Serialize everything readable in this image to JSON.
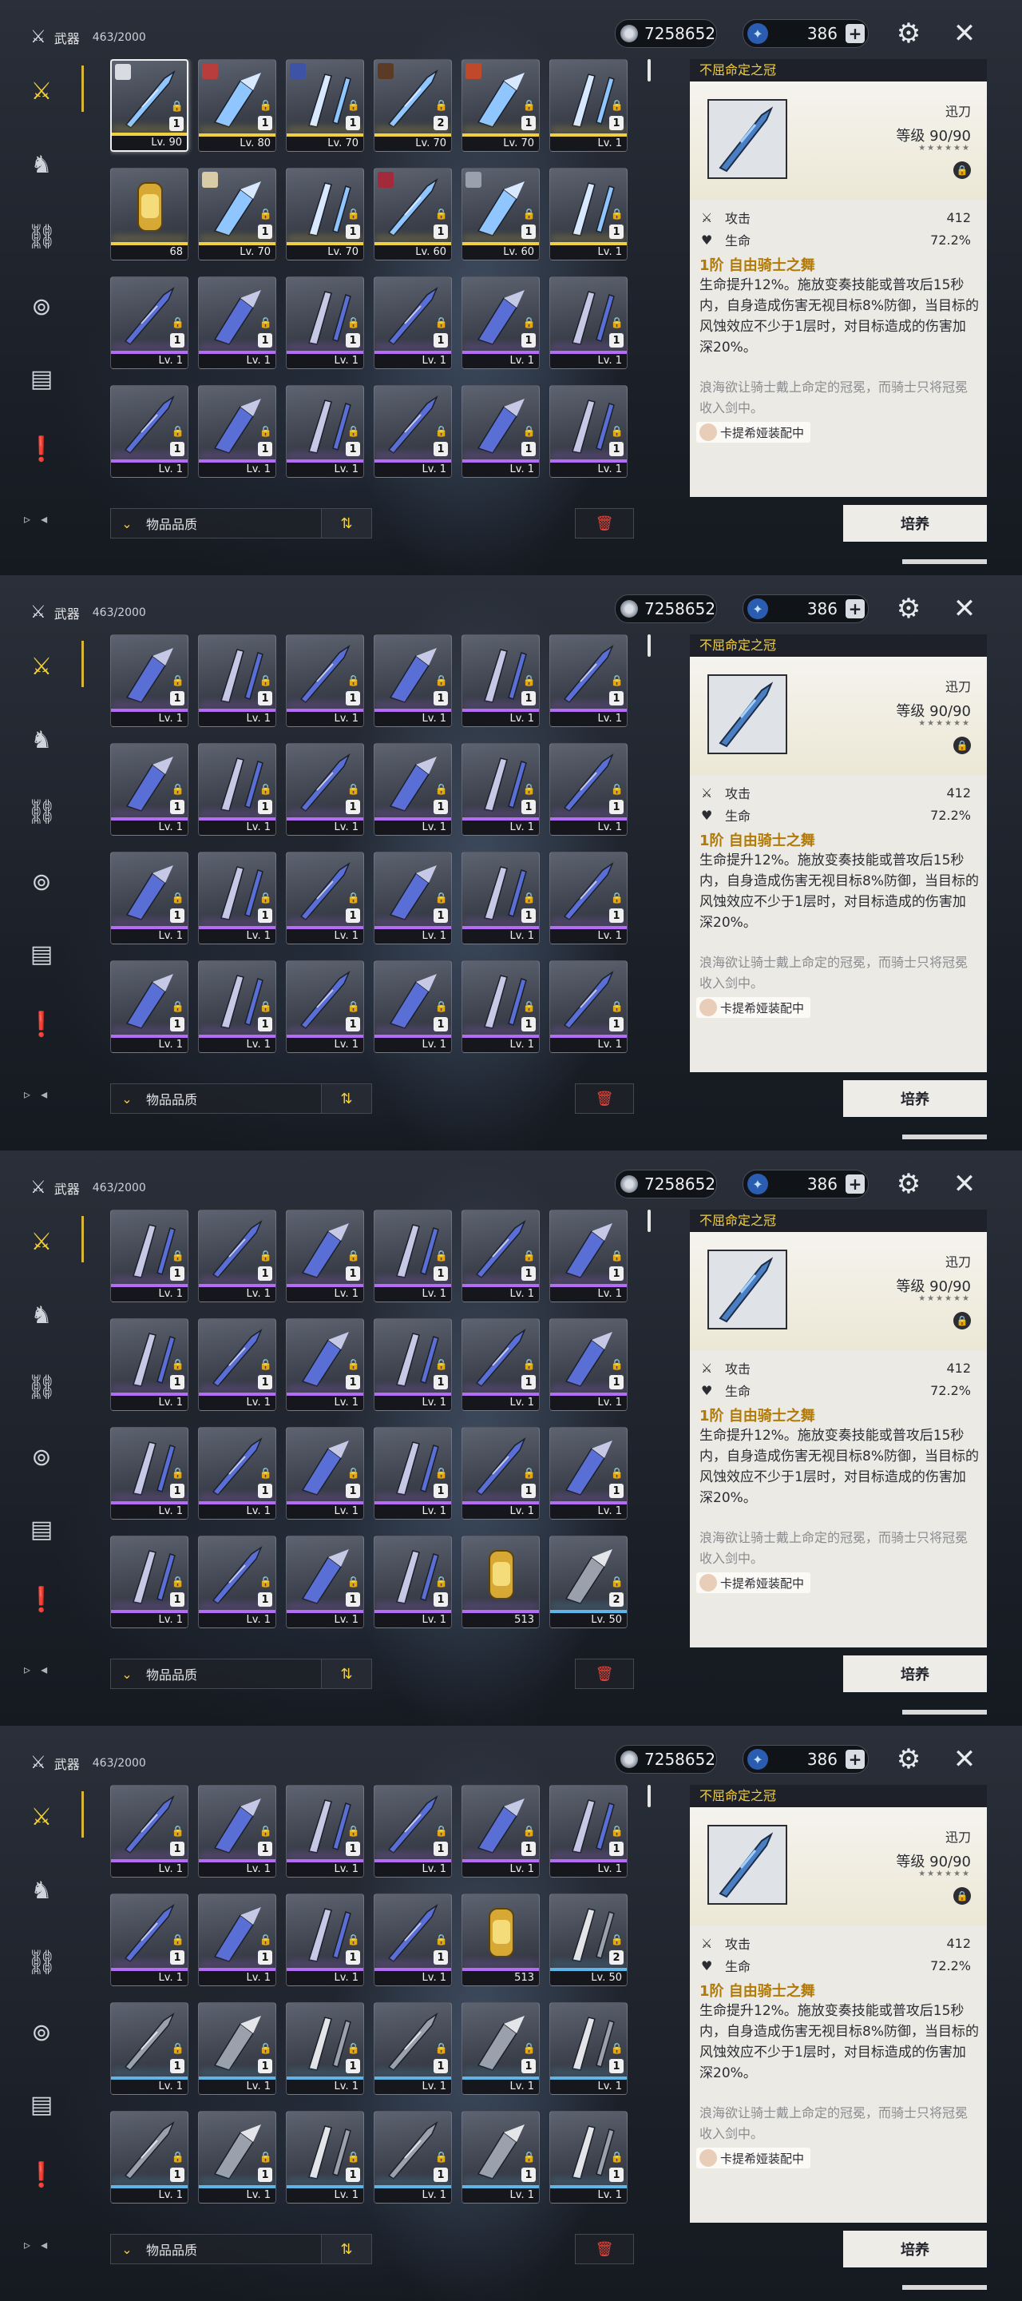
{
  "header": {
    "category_label": "武器",
    "inventory_count": "463/2000",
    "coins": "7258652",
    "stars": "386",
    "plus": "+"
  },
  "sidebar": {
    "icons": [
      "weapon-icon",
      "echo-icon",
      "ring-icon",
      "material-icon",
      "consumable-icon",
      "quest-item-icon"
    ]
  },
  "detail": {
    "title": "不屈命定之冠",
    "weapon_type": "迅刀",
    "level_label": "等级",
    "level": "90/90",
    "stars": "★★★★★★",
    "stat1_name": "攻击",
    "stat1_value": "412",
    "stat2_name": "生命",
    "stat2_value": "72.2%",
    "skill_name": "1阶 自由骑士之舞",
    "skill_desc": "生命提升12%。施放变奏技能或普攻后15秒内，自身造成伤害无视目标8%防御，当目标的风蚀效应不少于1层时，对目标造成的伤害加深20%。",
    "lore": "浪海欲让骑士戴上命定的冠冕，而骑士只将冠冕收入剑中。",
    "equipped_by": "卡提希娅装配中"
  },
  "footer": {
    "sort_label": "物品品质",
    "sort_icon": "⇅",
    "delete_icon": "🗑",
    "upgrade_label": "培养",
    "page_arrows": "▹ ◂"
  },
  "panels": [
    {
      "rows": [
        [
          {
            "r": 5,
            "lv": "Lv. 90",
            "badge": "1",
            "av": "#d8dbe2",
            "sel": true
          },
          {
            "r": 5,
            "lv": "Lv. 80",
            "badge": "1",
            "av": "#b93d3d"
          },
          {
            "r": 5,
            "lv": "Lv. 70",
            "badge": "1",
            "av": "#3d54a6"
          },
          {
            "r": 5,
            "lv": "Lv. 70",
            "badge": "2",
            "av": "#5b3b26"
          },
          {
            "r": 5,
            "lv": "Lv. 70",
            "badge": "1",
            "av": "#c0492b"
          },
          {
            "r": 5,
            "lv": "Lv. 1",
            "badge": "1"
          }
        ],
        [
          {
            "r": 5,
            "amt": "68",
            "item": true
          },
          {
            "r": 5,
            "lv": "Lv. 70",
            "badge": "1",
            "av": "#d9cba6"
          },
          {
            "r": 5,
            "lv": "Lv. 70",
            "badge": "1"
          },
          {
            "r": 5,
            "lv": "Lv. 60",
            "badge": "1",
            "av": "#a22a3a"
          },
          {
            "r": 5,
            "lv": "Lv. 60",
            "badge": "1",
            "av": "#9aa0ac"
          },
          {
            "r": 5,
            "lv": "Lv. 1",
            "badge": "1"
          }
        ],
        [
          {
            "r": 4,
            "lv": "Lv. 1",
            "badge": "1"
          },
          {
            "r": 4,
            "lv": "Lv. 1",
            "badge": "1"
          },
          {
            "r": 4,
            "lv": "Lv. 1",
            "badge": "1"
          },
          {
            "r": 4,
            "lv": "Lv. 1",
            "badge": "1"
          },
          {
            "r": 4,
            "lv": "Lv. 1",
            "badge": "1"
          },
          {
            "r": 4,
            "lv": "Lv. 1",
            "badge": "1"
          }
        ],
        [
          {
            "r": 4,
            "lv": "Lv. 1",
            "badge": "1"
          },
          {
            "r": 4,
            "lv": "Lv. 1",
            "badge": "1"
          },
          {
            "r": 4,
            "lv": "Lv. 1",
            "badge": "1"
          },
          {
            "r": 4,
            "lv": "Lv. 1",
            "badge": "1"
          },
          {
            "r": 4,
            "lv": "Lv. 1",
            "badge": "1"
          },
          {
            "r": 4,
            "lv": "Lv. 1",
            "badge": "1"
          }
        ]
      ]
    },
    {
      "rows": [
        [
          {
            "r": 4,
            "lv": "Lv. 1",
            "badge": "1"
          },
          {
            "r": 4,
            "lv": "Lv. 1",
            "badge": "1"
          },
          {
            "r": 4,
            "lv": "Lv. 1",
            "badge": "1"
          },
          {
            "r": 4,
            "lv": "Lv. 1",
            "badge": "1"
          },
          {
            "r": 4,
            "lv": "Lv. 1",
            "badge": "1"
          },
          {
            "r": 4,
            "lv": "Lv. 1",
            "badge": "1"
          }
        ],
        [
          {
            "r": 4,
            "lv": "Lv. 1",
            "badge": "1"
          },
          {
            "r": 4,
            "lv": "Lv. 1",
            "badge": "1"
          },
          {
            "r": 4,
            "lv": "Lv. 1",
            "badge": "1"
          },
          {
            "r": 4,
            "lv": "Lv. 1",
            "badge": "1"
          },
          {
            "r": 4,
            "lv": "Lv. 1",
            "badge": "1"
          },
          {
            "r": 4,
            "lv": "Lv. 1",
            "badge": "1"
          }
        ],
        [
          {
            "r": 4,
            "lv": "Lv. 1",
            "badge": "1"
          },
          {
            "r": 4,
            "lv": "Lv. 1",
            "badge": "1"
          },
          {
            "r": 4,
            "lv": "Lv. 1",
            "badge": "1"
          },
          {
            "r": 4,
            "lv": "Lv. 1",
            "badge": "1"
          },
          {
            "r": 4,
            "lv": "Lv. 1",
            "badge": "1"
          },
          {
            "r": 4,
            "lv": "Lv. 1",
            "badge": "1"
          }
        ],
        [
          {
            "r": 4,
            "lv": "Lv. 1",
            "badge": "1"
          },
          {
            "r": 4,
            "lv": "Lv. 1",
            "badge": "1"
          },
          {
            "r": 4,
            "lv": "Lv. 1",
            "badge": "1"
          },
          {
            "r": 4,
            "lv": "Lv. 1",
            "badge": "1"
          },
          {
            "r": 4,
            "lv": "Lv. 1",
            "badge": "1"
          },
          {
            "r": 4,
            "lv": "Lv. 1",
            "badge": "1"
          }
        ]
      ]
    },
    {
      "rows": [
        [
          {
            "r": 4,
            "lv": "Lv. 1",
            "badge": "1"
          },
          {
            "r": 4,
            "lv": "Lv. 1",
            "badge": "1"
          },
          {
            "r": 4,
            "lv": "Lv. 1",
            "badge": "1"
          },
          {
            "r": 4,
            "lv": "Lv. 1",
            "badge": "1"
          },
          {
            "r": 4,
            "lv": "Lv. 1",
            "badge": "1"
          },
          {
            "r": 4,
            "lv": "Lv. 1",
            "badge": "1"
          }
        ],
        [
          {
            "r": 4,
            "lv": "Lv. 1",
            "badge": "1"
          },
          {
            "r": 4,
            "lv": "Lv. 1",
            "badge": "1"
          },
          {
            "r": 4,
            "lv": "Lv. 1",
            "badge": "1"
          },
          {
            "r": 4,
            "lv": "Lv. 1",
            "badge": "1"
          },
          {
            "r": 4,
            "lv": "Lv. 1",
            "badge": "1"
          },
          {
            "r": 4,
            "lv": "Lv. 1",
            "badge": "1"
          }
        ],
        [
          {
            "r": 4,
            "lv": "Lv. 1",
            "badge": "1"
          },
          {
            "r": 4,
            "lv": "Lv. 1",
            "badge": "1"
          },
          {
            "r": 4,
            "lv": "Lv. 1",
            "badge": "1"
          },
          {
            "r": 4,
            "lv": "Lv. 1",
            "badge": "1"
          },
          {
            "r": 4,
            "lv": "Lv. 1",
            "badge": "1"
          },
          {
            "r": 4,
            "lv": "Lv. 1",
            "badge": "1"
          }
        ],
        [
          {
            "r": 4,
            "lv": "Lv. 1",
            "badge": "1"
          },
          {
            "r": 4,
            "lv": "Lv. 1",
            "badge": "1"
          },
          {
            "r": 4,
            "lv": "Lv. 1",
            "badge": "1"
          },
          {
            "r": 4,
            "lv": "Lv. 1",
            "badge": "1"
          },
          {
            "r": 4,
            "amt": "513",
            "item": true
          },
          {
            "r": 3,
            "lv": "Lv. 50",
            "badge": "2"
          }
        ]
      ]
    },
    {
      "rows": [
        [
          {
            "r": 4,
            "lv": "Lv. 1",
            "badge": "1"
          },
          {
            "r": 4,
            "lv": "Lv. 1",
            "badge": "1"
          },
          {
            "r": 4,
            "lv": "Lv. 1",
            "badge": "1"
          },
          {
            "r": 4,
            "lv": "Lv. 1",
            "badge": "1"
          },
          {
            "r": 4,
            "lv": "Lv. 1",
            "badge": "1"
          },
          {
            "r": 4,
            "lv": "Lv. 1",
            "badge": "1"
          }
        ],
        [
          {
            "r": 4,
            "lv": "Lv. 1",
            "badge": "1"
          },
          {
            "r": 4,
            "lv": "Lv. 1",
            "badge": "1"
          },
          {
            "r": 4,
            "lv": "Lv. 1",
            "badge": "1"
          },
          {
            "r": 4,
            "lv": "Lv. 1",
            "badge": "1"
          },
          {
            "r": 4,
            "amt": "513",
            "item": true
          },
          {
            "r": 3,
            "lv": "Lv. 50",
            "badge": "2"
          }
        ],
        [
          {
            "r": 3,
            "lv": "Lv. 1",
            "badge": "1"
          },
          {
            "r": 3,
            "lv": "Lv. 1",
            "badge": "1"
          },
          {
            "r": 3,
            "lv": "Lv. 1",
            "badge": "1"
          },
          {
            "r": 3,
            "lv": "Lv. 1",
            "badge": "1"
          },
          {
            "r": 3,
            "lv": "Lv. 1",
            "badge": "1"
          },
          {
            "r": 3,
            "lv": "Lv. 1",
            "badge": "1"
          }
        ],
        [
          {
            "r": 3,
            "lv": "Lv. 1",
            "badge": "1"
          },
          {
            "r": 3,
            "lv": "Lv. 1",
            "badge": "1"
          },
          {
            "r": 3,
            "lv": "Lv. 1",
            "badge": "1"
          },
          {
            "r": 3,
            "lv": "Lv. 1",
            "badge": "1"
          },
          {
            "r": 3,
            "lv": "Lv. 1",
            "badge": "1"
          },
          {
            "r": 3,
            "lv": "Lv. 1",
            "badge": "1"
          }
        ]
      ]
    }
  ],
  "colors": {
    "accent": "#f2cf3b",
    "rarity5": "#f0cf42",
    "rarity4": "#b46cf5",
    "rarity3": "#5fb6e6"
  }
}
